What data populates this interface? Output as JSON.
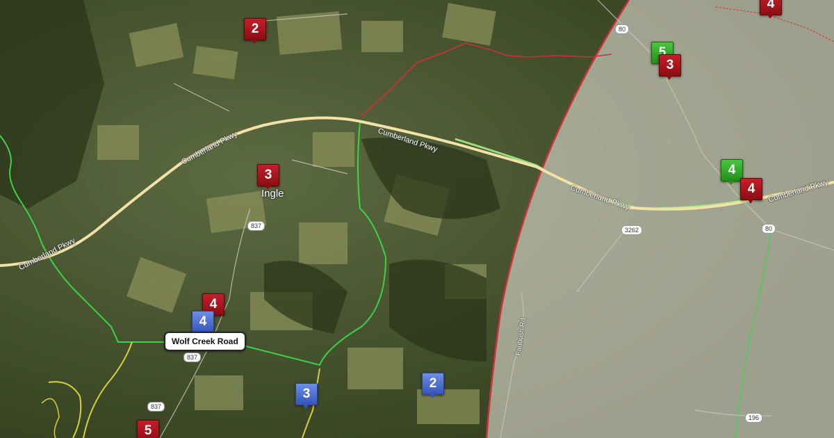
{
  "map": {
    "town": "Ingle",
    "roads": {
      "parkway_1": "Cumberland Pkwy",
      "parkway_2": "Cumberland Pkwy",
      "parkway_3": "Cumberland Pkwy",
      "parkway_4": "Cumberland Pkwy",
      "parkway_5": "Cumberland Pkwy",
      "faubush": "Faubush Rd"
    },
    "shields": [
      "837",
      "837",
      "837",
      "3262",
      "80",
      "80",
      "196"
    ],
    "callout": "Wolf Creek Road",
    "markers": [
      {
        "label": "2",
        "color": "red"
      },
      {
        "label": "3",
        "color": "red"
      },
      {
        "label": "4",
        "color": "red"
      },
      {
        "label": "4",
        "color": "blue"
      },
      {
        "label": "3",
        "color": "blue"
      },
      {
        "label": "2",
        "color": "blue"
      },
      {
        "label": "5",
        "color": "red"
      },
      {
        "label": "5",
        "color": "green"
      },
      {
        "label": "3",
        "color": "red"
      },
      {
        "label": "4",
        "color": "green"
      },
      {
        "label": "4",
        "color": "red"
      },
      {
        "label": "4",
        "color": "red"
      }
    ],
    "colors": {
      "marker_red": "#a3121b",
      "marker_blue": "#4a6ed0",
      "marker_green": "#2ea826",
      "route_green": "#39d44a",
      "route_yellow": "#d6d23a",
      "boundary_red": "#d0303a"
    }
  }
}
